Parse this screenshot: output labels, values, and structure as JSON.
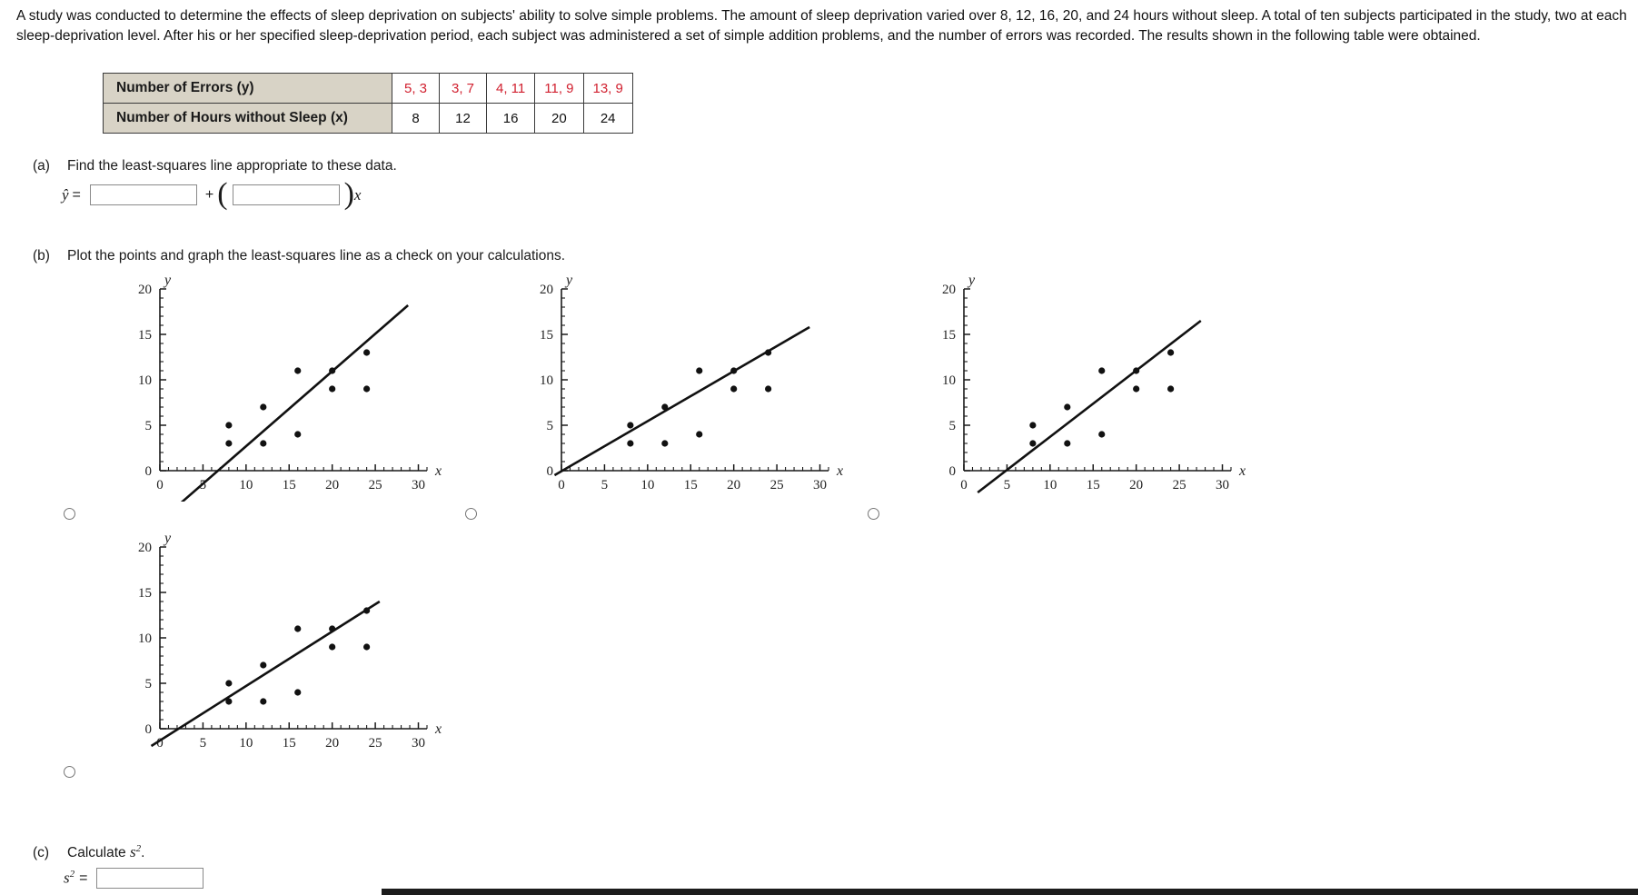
{
  "problem": {
    "text": "A study was conducted to determine the effects of sleep deprivation on subjects' ability to solve simple problems. The amount of sleep deprivation varied over 8, 12, 16, 20, and 24 hours without sleep. A total of ten subjects participated in the study, two at each sleep-deprivation level. After his or her specified sleep-deprivation period, each subject was administered a set of simple addition problems, and the number of errors was recorded. The results shown in the following table were obtained."
  },
  "table": {
    "row_errors_label": "Number of Errors (y)",
    "row_hours_label": "Number of Hours without Sleep (x)",
    "errors": [
      "5, 3",
      "3, 7",
      "4, 11",
      "11, 9",
      "13, 9"
    ],
    "hours": [
      "8",
      "12",
      "16",
      "20",
      "24"
    ],
    "header_bg": "#d8d3c6",
    "value_color": "#d1202f"
  },
  "parts": {
    "a": {
      "tag": "(a)",
      "text": "Find the least-squares line appropriate to these data.",
      "lhs": "ŷ",
      "equals": "=",
      "plus": "+",
      "x_suffix": "x",
      "intercept_value": "",
      "slope_value": ""
    },
    "b": {
      "tag": "(b)",
      "text": "Plot the points and graph the least-squares line as a check on your calculations."
    },
    "c": {
      "tag": "(c)",
      "text_prefix": "Calculate ",
      "symbol": "s",
      "exponent": "2",
      "text_suffix": ".",
      "equals": "=",
      "value": ""
    }
  },
  "chart_data": [
    {
      "id": "plot-1",
      "type": "scatter",
      "xlabel": "x",
      "ylabel": "y",
      "xlim": [
        0,
        31
      ],
      "ylim": [
        0,
        20
      ],
      "xticks": [
        0,
        5,
        10,
        15,
        20,
        25,
        30
      ],
      "yticks": [
        0,
        5,
        10,
        15,
        20
      ],
      "grid": false,
      "points": [
        {
          "x": 8,
          "y": 5
        },
        {
          "x": 8,
          "y": 3
        },
        {
          "x": 12,
          "y": 7
        },
        {
          "x": 12,
          "y": 3
        },
        {
          "x": 16,
          "y": 11
        },
        {
          "x": 16,
          "y": 4
        },
        {
          "x": 20,
          "y": 11
        },
        {
          "x": 20,
          "y": 9
        },
        {
          "x": 24,
          "y": 13
        },
        {
          "x": 24,
          "y": 9
        }
      ],
      "line": {
        "x0": 2.5,
        "y0": -3.5,
        "x1": 28.8,
        "y1": 18.2
      },
      "selected": false
    },
    {
      "id": "plot-2",
      "type": "scatter",
      "xlabel": "x",
      "ylabel": "y",
      "xlim": [
        0,
        31
      ],
      "ylim": [
        0,
        20
      ],
      "xticks": [
        0,
        5,
        10,
        15,
        20,
        25,
        30
      ],
      "yticks": [
        0,
        5,
        10,
        15,
        20
      ],
      "grid": false,
      "points": [
        {
          "x": 8,
          "y": 5
        },
        {
          "x": 8,
          "y": 3
        },
        {
          "x": 12,
          "y": 7
        },
        {
          "x": 12,
          "y": 3
        },
        {
          "x": 16,
          "y": 11
        },
        {
          "x": 16,
          "y": 4
        },
        {
          "x": 20,
          "y": 11
        },
        {
          "x": 20,
          "y": 9
        },
        {
          "x": 24,
          "y": 13
        },
        {
          "x": 24,
          "y": 9
        }
      ],
      "line": {
        "x0": -0.8,
        "y0": -0.5,
        "x1": 28.8,
        "y1": 15.8
      },
      "selected": false
    },
    {
      "id": "plot-3",
      "type": "scatter",
      "xlabel": "x",
      "ylabel": "y",
      "xlim": [
        0,
        31
      ],
      "ylim": [
        0,
        20
      ],
      "xticks": [
        0,
        5,
        10,
        15,
        20,
        25,
        30
      ],
      "yticks": [
        0,
        5,
        10,
        15,
        20
      ],
      "grid": false,
      "points": [
        {
          "x": 8,
          "y": 5
        },
        {
          "x": 8,
          "y": 3
        },
        {
          "x": 12,
          "y": 7
        },
        {
          "x": 12,
          "y": 3
        },
        {
          "x": 16,
          "y": 11
        },
        {
          "x": 16,
          "y": 4
        },
        {
          "x": 20,
          "y": 11
        },
        {
          "x": 20,
          "y": 9
        },
        {
          "x": 24,
          "y": 13
        },
        {
          "x": 24,
          "y": 9
        }
      ],
      "line": {
        "x0": 1.6,
        "y0": -2.4,
        "x1": 27.5,
        "y1": 16.5
      },
      "selected": false
    },
    {
      "id": "plot-4",
      "type": "scatter",
      "xlabel": "x",
      "ylabel": "y",
      "xlim": [
        0,
        31
      ],
      "ylim": [
        0,
        20
      ],
      "xticks": [
        0,
        5,
        10,
        15,
        20,
        25,
        30
      ],
      "yticks": [
        0,
        5,
        10,
        15,
        20
      ],
      "grid": false,
      "points": [
        {
          "x": 8,
          "y": 5
        },
        {
          "x": 8,
          "y": 3
        },
        {
          "x": 12,
          "y": 7
        },
        {
          "x": 12,
          "y": 3
        },
        {
          "x": 16,
          "y": 11
        },
        {
          "x": 16,
          "y": 4
        },
        {
          "x": 20,
          "y": 11
        },
        {
          "x": 20,
          "y": 9
        },
        {
          "x": 24,
          "y": 13
        },
        {
          "x": 24,
          "y": 9
        }
      ],
      "line": {
        "x0": -1.0,
        "y0": -1.9,
        "x1": 25.5,
        "y1": 14.0
      },
      "selected": false
    }
  ]
}
